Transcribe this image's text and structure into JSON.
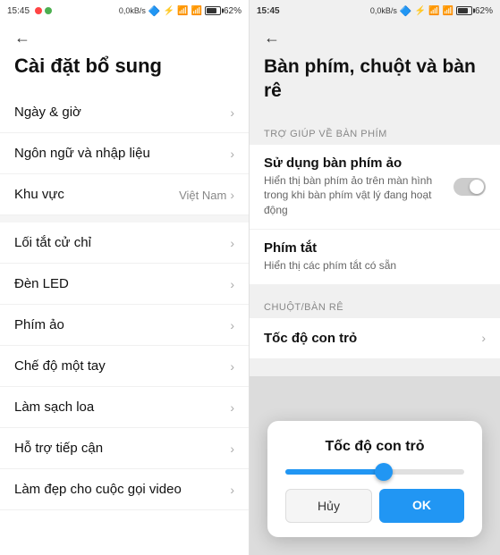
{
  "left": {
    "status": {
      "time": "15:45",
      "network": "0,0kB/s",
      "battery": "62%"
    },
    "back_label": "←",
    "title": "Cài đặt bổ sung",
    "menu_items": [
      {
        "label": "Ngày & giờ",
        "value": "",
        "has_value": false
      },
      {
        "label": "Ngôn ngữ và nhập liệu",
        "value": "",
        "has_value": false
      },
      {
        "label": "Khu vực",
        "value": "Việt Nam",
        "has_value": true
      },
      {
        "label": "Lối tắt cử chỉ",
        "value": "",
        "has_value": false
      },
      {
        "label": "Đèn LED",
        "value": "",
        "has_value": false
      },
      {
        "label": "Phím ảo",
        "value": "",
        "has_value": false
      },
      {
        "label": "Chế độ một tay",
        "value": "",
        "has_value": false
      },
      {
        "label": "Làm sạch loa",
        "value": "",
        "has_value": false
      },
      {
        "label": "Hỗ trợ tiếp cận",
        "value": "",
        "has_value": false
      },
      {
        "label": "Làm đẹp cho cuộc gọi video",
        "value": "",
        "has_value": false
      }
    ]
  },
  "right": {
    "status": {
      "time": "15:45",
      "network": "0,0kB/s",
      "battery": "62%"
    },
    "back_label": "←",
    "title": "Bàn phím, chuột và bàn rê",
    "keyboard_section": "TRỢ GIÚP VỀ BÀN PHÍM",
    "keyboard_items": [
      {
        "label": "Sử dụng bàn phím ảo",
        "desc": "Hiển thị bàn phím ảo trên màn hình trong khi bàn phím vật lý đang hoạt động",
        "has_toggle": true,
        "toggle_on": false
      },
      {
        "label": "Phím tắt",
        "desc": "Hiển thị các phím tắt có sẵn",
        "has_toggle": false
      }
    ],
    "mouse_section": "CHUỘT/BÀN RÊ",
    "mouse_items": [
      {
        "label": "Tốc độ con trỏ"
      }
    ],
    "dialog": {
      "title": "Tốc độ con trỏ",
      "slider_percent": 55,
      "cancel_label": "Hủy",
      "ok_label": "OK"
    }
  }
}
